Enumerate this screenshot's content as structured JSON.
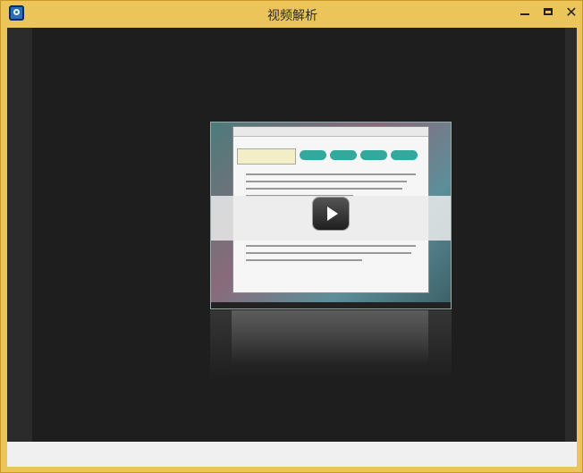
{
  "window": {
    "title": "视频解析",
    "controls": {
      "minimize": "minimize",
      "maximize": "maximize",
      "close": "✕"
    }
  },
  "player": {
    "state": "paused",
    "play_icon": "play-icon"
  },
  "colors": {
    "titlebar": "#ecc55a",
    "content_bg": "#2b2b2b",
    "stage_bg": "#1e1e1e",
    "statusbar": "#f0f0f0"
  }
}
